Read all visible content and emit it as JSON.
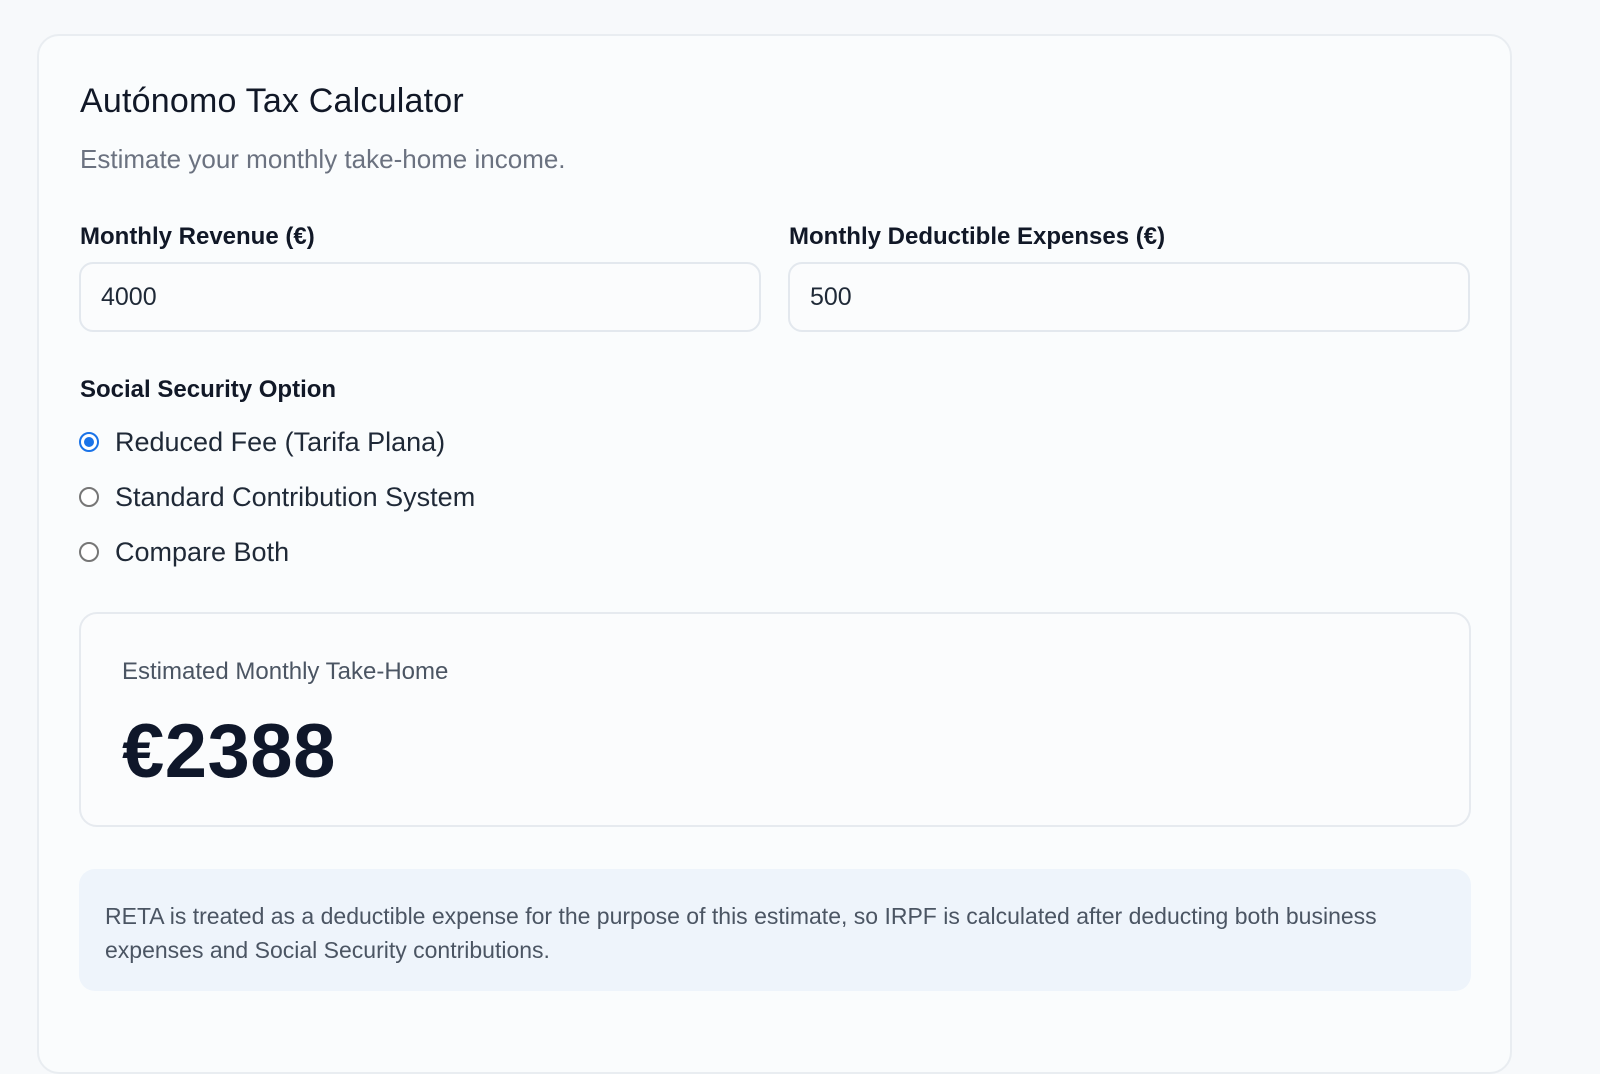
{
  "calculator": {
    "title": "Autónomo Tax Calculator",
    "subtitle": "Estimate your monthly take-home income."
  },
  "fields": {
    "revenue": {
      "label": "Monthly Revenue (€)",
      "value": "4000"
    },
    "expenses": {
      "label": "Monthly Deductible Expenses (€)",
      "value": "500"
    }
  },
  "social_security": {
    "label": "Social Security Option",
    "options": [
      {
        "label": "Reduced Fee (Tarifa Plana)",
        "selected": true
      },
      {
        "label": "Standard Contribution System",
        "selected": false
      },
      {
        "label": "Compare Both",
        "selected": false
      }
    ]
  },
  "result": {
    "label": "Estimated Monthly Take-Home",
    "value": "€2388"
  },
  "note": {
    "text": "RETA is treated as a deductible expense for the purpose of this estimate, so IRPF is calculated after deducting both business expenses and Social Security contributions."
  },
  "colors": {
    "accent": "#1a73e8",
    "note_background": "#eef4fb"
  }
}
